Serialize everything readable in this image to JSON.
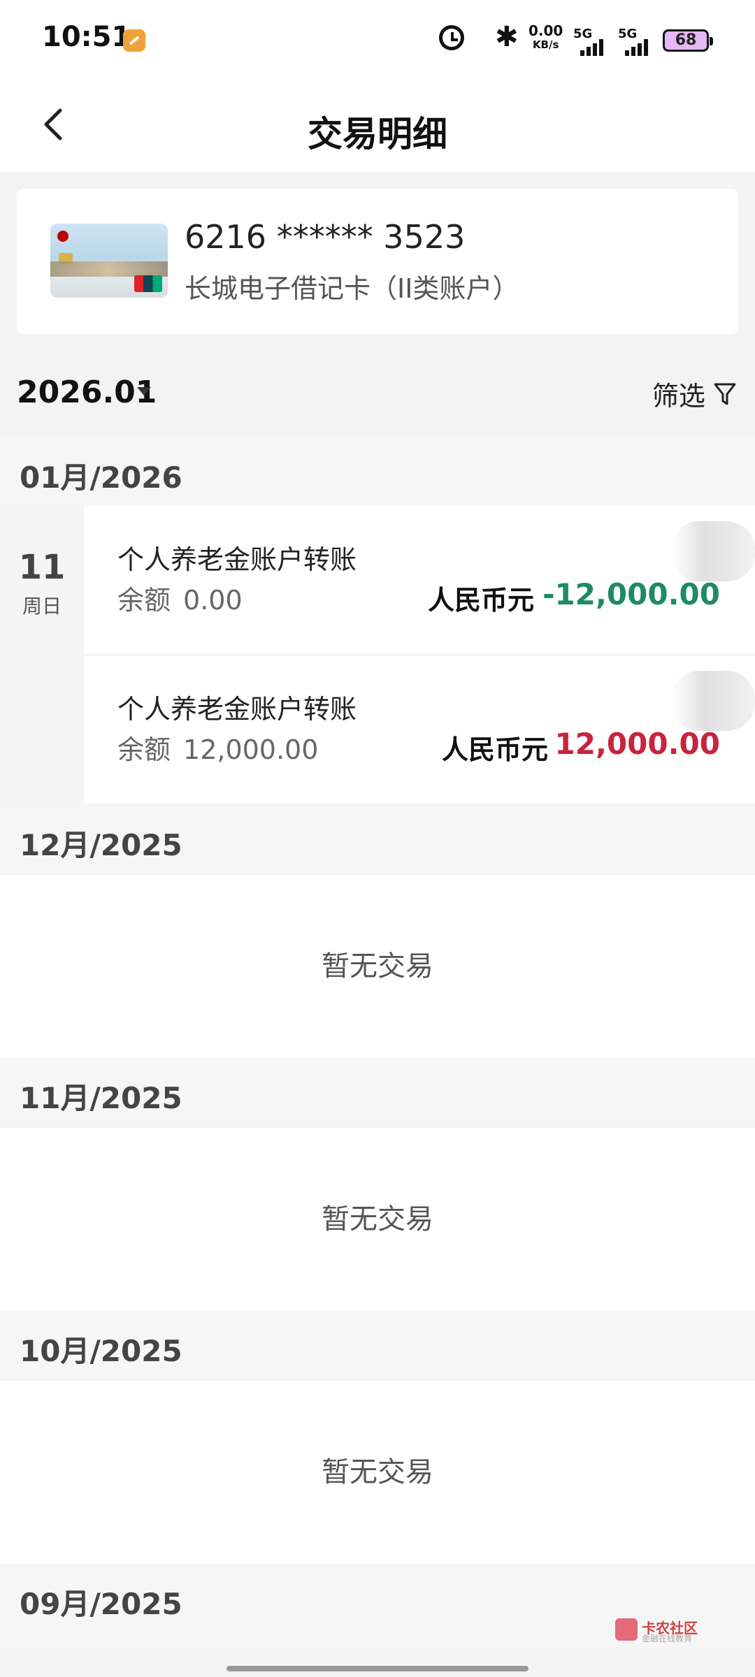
{
  "status_bar": {
    "time": "10:51",
    "speed_value": "0.00",
    "speed_unit": "KB/s",
    "network1": "5G",
    "network2": "5G",
    "battery": "68"
  },
  "header": {
    "title": "交易明细",
    "back_icon": "chevron-left-icon"
  },
  "card": {
    "number": "6216 ****** 3523",
    "type": "长城电子借记卡（II类账户）"
  },
  "filter": {
    "month": "2026.01",
    "label": "筛选",
    "icon": "funnel-icon"
  },
  "sections": [
    {
      "header": "01月/2026"
    },
    {
      "header": "12月/2025",
      "empty": "暂无交易"
    },
    {
      "header": "11月/2025",
      "empty": "暂无交易"
    },
    {
      "header": "10月/2025",
      "empty": "暂无交易"
    },
    {
      "header": "09月/2025"
    }
  ],
  "transactions": {
    "day": "11",
    "weekday": "周日",
    "items": [
      {
        "title": "个人养老金账户转账",
        "balance_label": "余额",
        "balance": "0.00",
        "currency": "人民币元",
        "amount": "-12,000.00",
        "amount_color": "#1e8a68"
      },
      {
        "title": "个人养老金账户转账",
        "balance_label": "余额",
        "balance": "12,000.00",
        "currency": "人民币元",
        "amount": "12,000.00",
        "amount_color": "#c8243d"
      }
    ]
  },
  "watermark": {
    "text": "卡农社区",
    "sub": "金融在线教育"
  }
}
